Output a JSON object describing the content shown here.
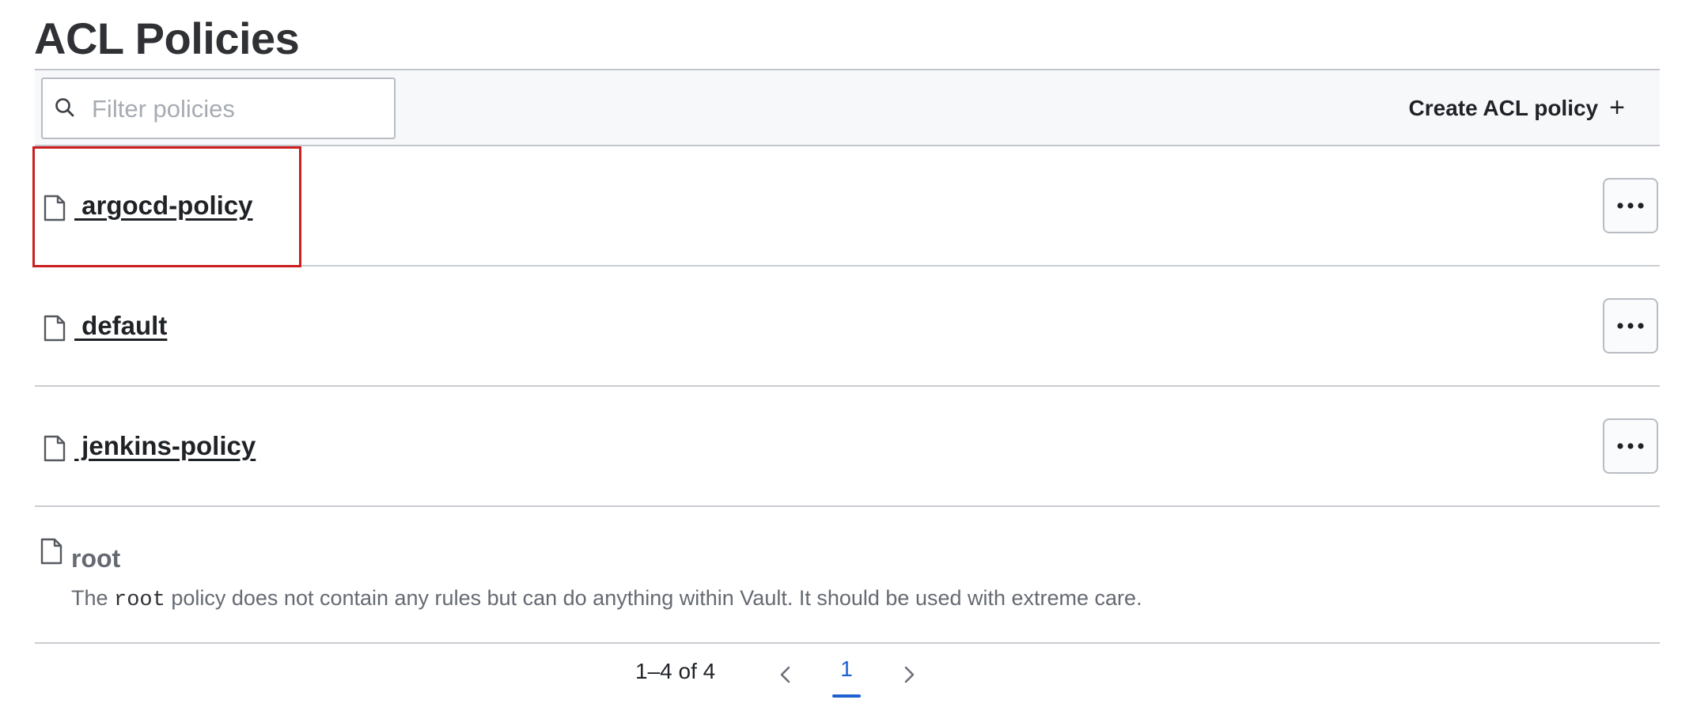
{
  "page": {
    "title": "ACL Policies"
  },
  "toolbar": {
    "filter_placeholder": "Filter policies",
    "filter_value": "",
    "create_label": "Create ACL policy",
    "create_icon": "plus-icon"
  },
  "policies": [
    {
      "name": " argocd-policy",
      "icon": "file-icon",
      "highlighted": true
    },
    {
      "name": " default",
      "icon": "file-icon",
      "highlighted": false
    },
    {
      "name": " jenkins-policy",
      "icon": "file-icon",
      "highlighted": false
    }
  ],
  "root_policy": {
    "name": "root",
    "desc_prefix": "The ",
    "desc_code": "root",
    "desc_suffix": " policy does not contain any rules but can do anything within Vault. It should be used with extreme care."
  },
  "pagination": {
    "info": "1–4 of 4",
    "current_page": "1"
  },
  "colors": {
    "highlight": "#cc1e1e",
    "pagination_active": "#1f5fd0"
  }
}
